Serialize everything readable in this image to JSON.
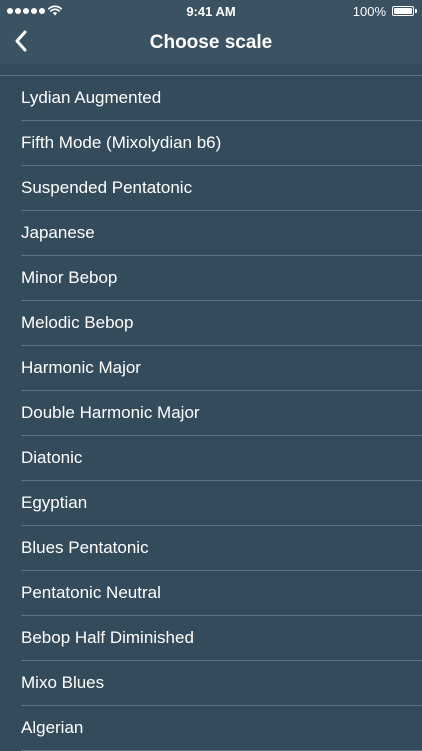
{
  "status_bar": {
    "time": "9:41 AM",
    "battery_percent": "100%",
    "signal_icon": "signal-dots-icon",
    "wifi_icon": "wifi-icon",
    "battery_icon": "battery-icon"
  },
  "nav": {
    "title": "Choose scale",
    "back_icon": "chevron-left-icon"
  },
  "colors": {
    "background": "#344b5b",
    "bar": "#3b5262",
    "separator": "#5e7282",
    "text": "#ffffff"
  },
  "scales": [
    {
      "label": "Lydian Augmented"
    },
    {
      "label": "Fifth Mode (Mixolydian b6)"
    },
    {
      "label": "Suspended Pentatonic"
    },
    {
      "label": "Japanese"
    },
    {
      "label": "Minor Bebop"
    },
    {
      "label": "Melodic Bebop"
    },
    {
      "label": "Harmonic Major"
    },
    {
      "label": "Double Harmonic Major"
    },
    {
      "label": "Diatonic"
    },
    {
      "label": "Egyptian"
    },
    {
      "label": "Blues Pentatonic"
    },
    {
      "label": "Pentatonic Neutral"
    },
    {
      "label": "Bebop Half Diminished"
    },
    {
      "label": "Mixo Blues"
    },
    {
      "label": "Algerian"
    }
  ]
}
